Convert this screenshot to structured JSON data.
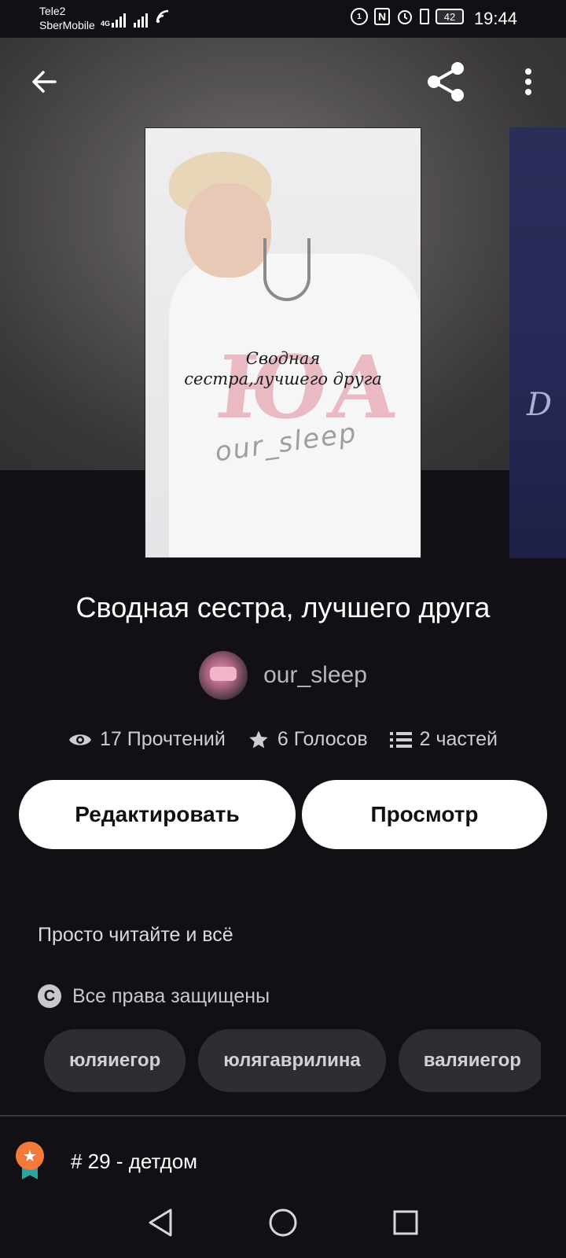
{
  "status_bar": {
    "carrier_1": "Tele2",
    "carrier_2": "SberMobile",
    "network": "4G",
    "battery": "42",
    "time": "19:44",
    "icons": [
      "signal-icon",
      "wifi-icon",
      "ring-icon",
      "nfc-icon",
      "alarm-icon",
      "vibrate-icon",
      "battery-icon"
    ]
  },
  "toolbar": {
    "back_icon": "arrow-left-icon",
    "share_icon": "share-icon",
    "more_icon": "more-vertical-icon"
  },
  "cover": {
    "title_line_1": "Сводная",
    "title_line_2": "сестра,лучшего друга",
    "author_mark": "our_sleep"
  },
  "next_cover": {
    "text": "D"
  },
  "story": {
    "title": "Сводная сестра, лучшего друга",
    "author": "our_sleep",
    "stats": [
      {
        "icon": "eye-icon",
        "label": "17 Прочтений"
      },
      {
        "icon": "star-icon",
        "label": "6 Голосов"
      },
      {
        "icon": "list-icon",
        "label": "2 частей"
      }
    ],
    "edit_label": "Редактировать",
    "preview_label": "Просмотр",
    "description": "Просто читайте и всё",
    "rights": "Все права защищены",
    "tags": [
      "юляиегор",
      "юлягаврилина",
      "валяиегор"
    ],
    "rank": "# 29 - детдом"
  },
  "colors": {
    "background": "#121015",
    "button_bg": "#ffffff",
    "tag_bg": "#2f2d33",
    "badge_orange": "#f47a3c",
    "badge_teal": "#2fa3a0"
  }
}
